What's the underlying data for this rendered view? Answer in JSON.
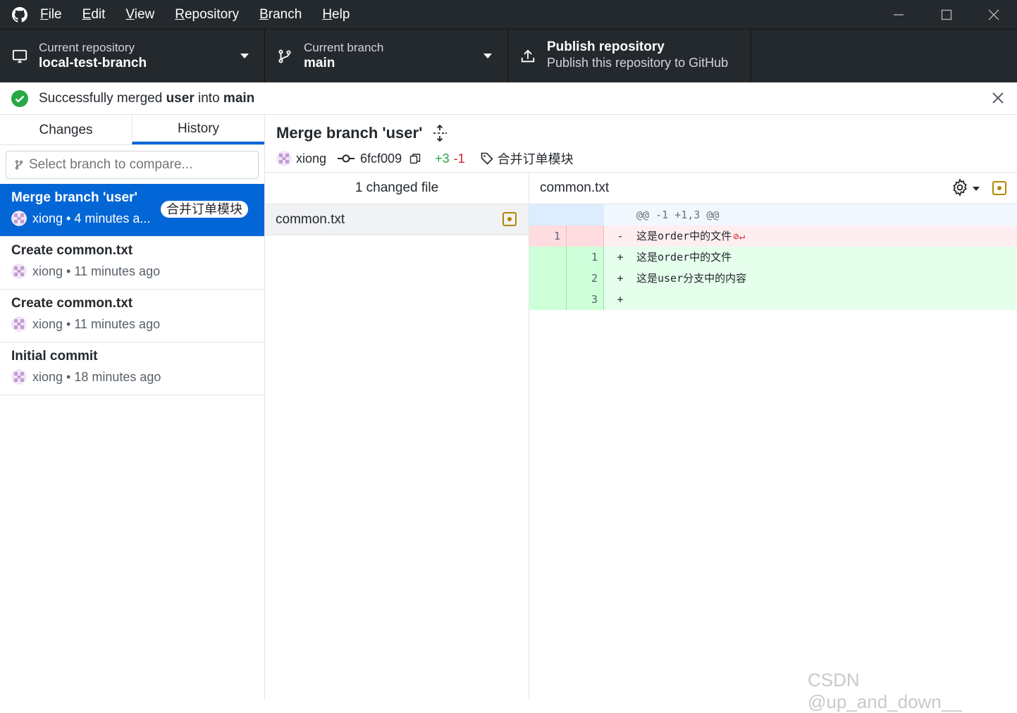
{
  "titlebar": {
    "menu": [
      {
        "pre": "",
        "key": "F",
        "post": "ile"
      },
      {
        "pre": "",
        "key": "E",
        "post": "dit"
      },
      {
        "pre": "",
        "key": "V",
        "post": "iew"
      },
      {
        "pre": "",
        "key": "R",
        "post": "epository"
      },
      {
        "pre": "",
        "key": "B",
        "post": "ranch"
      },
      {
        "pre": "",
        "key": "H",
        "post": "elp"
      }
    ]
  },
  "toolbar": {
    "repo_label": "Current repository",
    "repo_value": "local-test-branch",
    "branch_label": "Current branch",
    "branch_value": "main",
    "publish_title": "Publish repository",
    "publish_sub": "Publish this repository to GitHub"
  },
  "banner": {
    "pre": "Successfully merged ",
    "source": "user",
    "mid": " into ",
    "target": "main"
  },
  "sidebar": {
    "tab_changes": "Changes",
    "tab_history": "History",
    "compare_placeholder": "Select branch to compare..."
  },
  "commits": [
    {
      "title": "Merge branch 'user'",
      "author": "xiong",
      "time": "4 minutes a...",
      "tag": "合并订单模块"
    },
    {
      "title": "Create common.txt",
      "author": "xiong",
      "time": "11 minutes ago"
    },
    {
      "title": "Create common.txt",
      "author": "xiong",
      "time": "11 minutes ago"
    },
    {
      "title": "Initial commit",
      "author": "xiong",
      "time": "18 minutes ago"
    }
  ],
  "commit_detail": {
    "title": "Merge branch 'user'",
    "author": "xiong",
    "sha": "6fcf009",
    "additions": "+3",
    "deletions": "-1",
    "tag": "合并订单模块"
  },
  "files": {
    "header": "1 changed file",
    "items": [
      "common.txt"
    ]
  },
  "diff": {
    "filename": "common.txt",
    "hunk": "@@ -1 +1,3 @@",
    "lines": [
      {
        "type": "del",
        "old": "1",
        "new": "",
        "sign": "-",
        "text": "这是order中的文件",
        "noeol": "⊘↵"
      },
      {
        "type": "add",
        "old": "",
        "new": "1",
        "sign": "+",
        "text": "这是order中的文件"
      },
      {
        "type": "add",
        "old": "",
        "new": "2",
        "sign": "+",
        "text": "这是user分支中的内容"
      },
      {
        "type": "add",
        "old": "",
        "new": "3",
        "sign": "+",
        "text": ""
      }
    ]
  },
  "watermark": "CSDN @up_and_down__",
  "colors": {
    "accent": "#0366d6",
    "titlebar": "#24292e",
    "success": "#28a745",
    "danger": "#cb2431",
    "modified": "#b08800"
  }
}
